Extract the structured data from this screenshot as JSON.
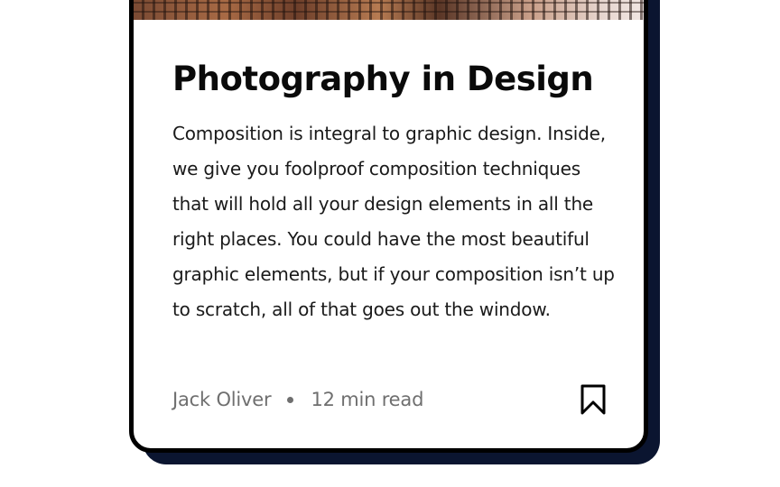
{
  "card": {
    "title": "Photography in Design",
    "body": "Composition is integral to graphic design. Inside, we give you foolproof composition techniques that will hold all your design elements in all the right places. You could have the most beautiful graphic elements, but if your composition isn’t up to scratch, all of that goes out the window.",
    "author": "Jack Oliver",
    "read_time": "12 min read",
    "image_icon": "building-photo",
    "bookmark_icon": "bookmark-icon"
  },
  "colors": {
    "card_border": "#000000",
    "card_shadow": "#0b1530",
    "title": "#0a0a0a",
    "body": "#1a1a1a",
    "meta": "#6f6f6f"
  }
}
